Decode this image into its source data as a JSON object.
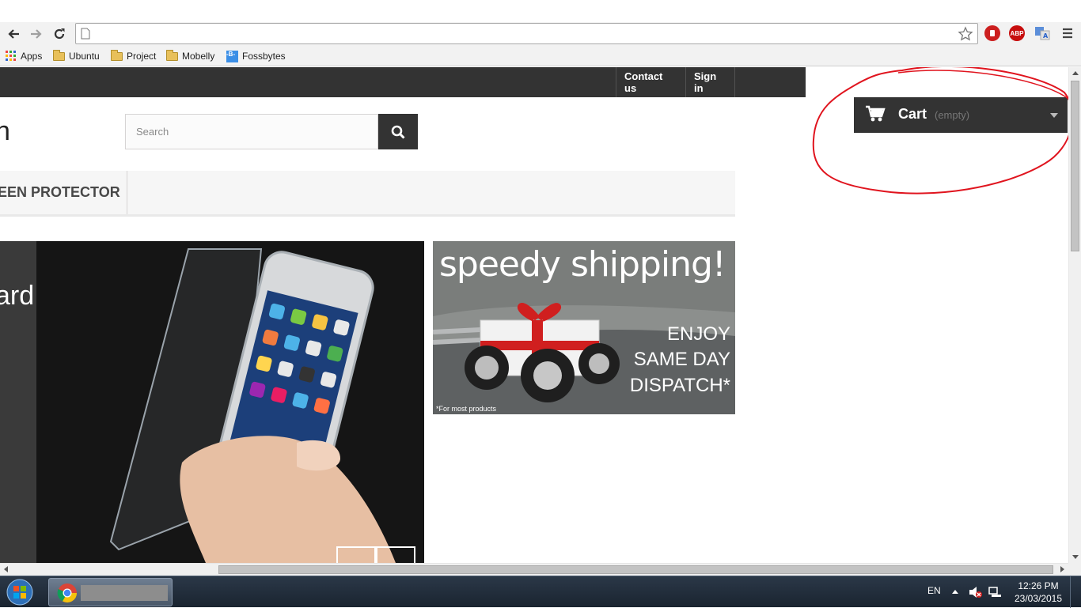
{
  "browser": {
    "address_value": "",
    "bookmarks": [
      "Apps",
      "Ubuntu",
      "Project",
      "Mobelly",
      "Fossbytes"
    ],
    "extensions": [
      "stop-extension-icon",
      "adblock-plus-icon",
      "translate-icon"
    ],
    "abp_label": "ABP"
  },
  "site": {
    "nav": {
      "contact": "Contact us",
      "signin": "Sign in"
    },
    "logo_partial": "n",
    "search": {
      "placeholder": "Search"
    },
    "menu": {
      "partial_item": "EEN PROTECTOR"
    },
    "slider": {
      "heading_partial": "ard"
    },
    "promo": {
      "title": "speedy shipping!",
      "line1": "ENJOY",
      "line2": "SAME DAY",
      "line3": "DISPATCH*",
      "footnote": "*For most products"
    },
    "cart": {
      "label": "Cart",
      "status": "(empty)"
    },
    "colors": {
      "dark": "#333333",
      "annotation": "#e0141e"
    }
  },
  "taskbar": {
    "language": "EN",
    "time": "12:26 PM",
    "date": "23/03/2015"
  }
}
